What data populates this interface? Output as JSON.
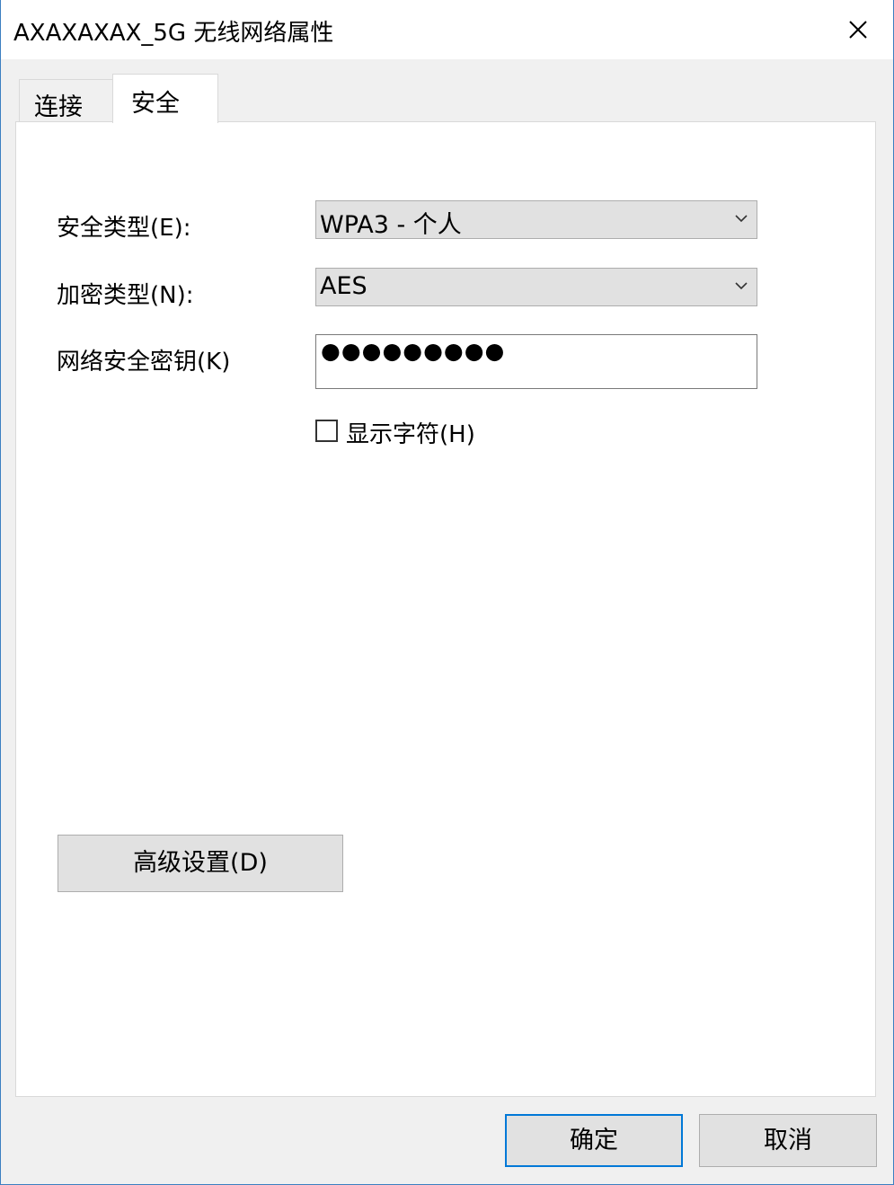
{
  "window": {
    "title": "AXAXAXAX_5G 无线网络属性",
    "close_icon": "close-icon"
  },
  "tabs": [
    {
      "label": "连接",
      "active": false
    },
    {
      "label": "安全",
      "active": true
    }
  ],
  "security": {
    "security_type_label": "安全类型(E):",
    "security_type_value": "WPA3 - 个人",
    "encryption_type_label": "加密类型(N):",
    "encryption_type_value": "AES",
    "network_key_label": "网络安全密钥(K)",
    "network_key_value": "●●●●●●●●●",
    "show_characters_label": "显示字符(H)",
    "show_characters_checked": false,
    "advanced_button": "高级设置(D)"
  },
  "footer": {
    "ok_label": "确定",
    "cancel_label": "取消"
  },
  "colors": {
    "accent": "#0078d7",
    "button_bg": "#e1e1e1",
    "dialog_bg": "#f0f0f0"
  }
}
